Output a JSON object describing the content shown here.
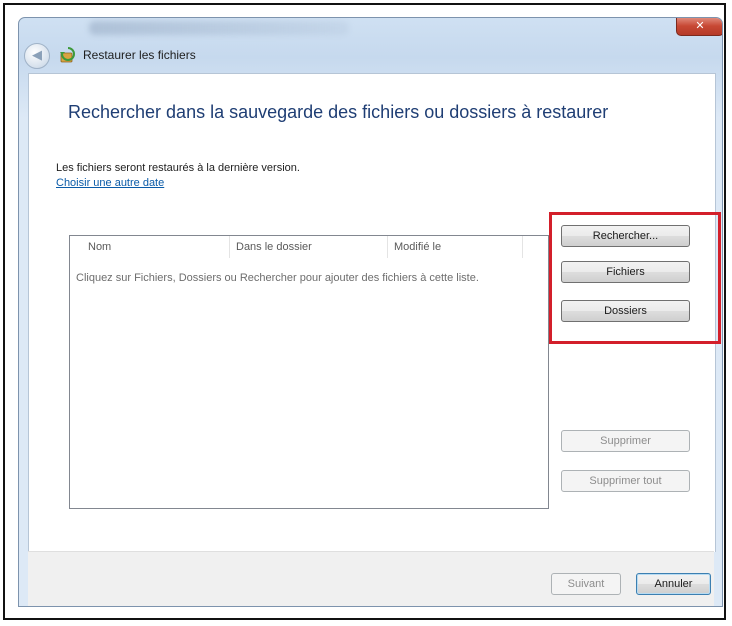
{
  "window": {
    "title": "Restaurer les fichiers",
    "close_glyph": "✕",
    "back_glyph": "◀"
  },
  "main": {
    "heading": "Rechercher dans la sauvegarde des fichiers ou dossiers à restaurer",
    "info": "Les fichiers seront restaurés à la dernière version.",
    "link": "Choisir une autre date"
  },
  "file_list": {
    "columns": [
      "Nom",
      "Dans le dossier",
      "Modifié le"
    ],
    "empty_message": "Cliquez sur Fichiers, Dossiers ou Rechercher pour ajouter des fichiers à cette liste."
  },
  "side_buttons": {
    "search": "Rechercher...",
    "files": "Fichiers",
    "folders": "Dossiers",
    "remove": "Supprimer",
    "remove_all": "Supprimer tout"
  },
  "footer": {
    "next": "Suivant",
    "cancel": "Annuler"
  },
  "colors": {
    "heading": "#1f3e74",
    "link": "#0a5ba8",
    "highlight": "#d31f2a"
  }
}
